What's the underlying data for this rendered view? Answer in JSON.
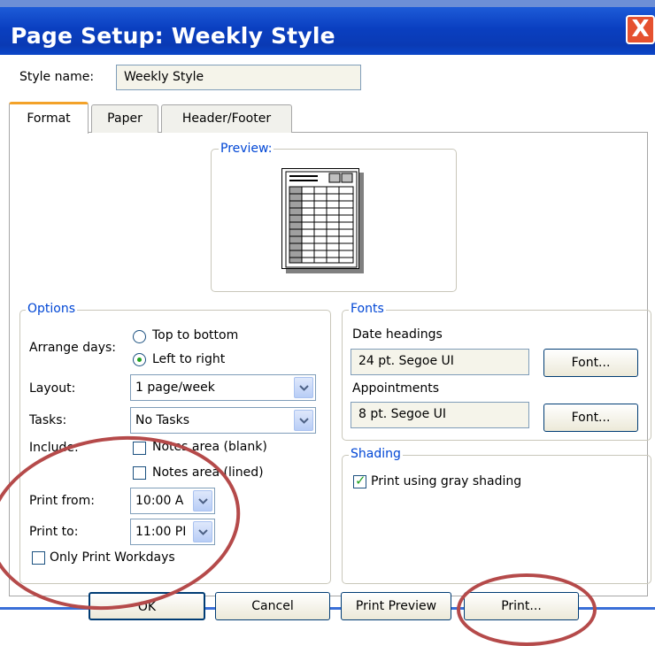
{
  "dialog": {
    "title": "Page Setup: Weekly Style",
    "close_glyph": "X"
  },
  "style_name": {
    "label": "Style name:",
    "value": "Weekly Style"
  },
  "tabs": [
    {
      "label": "Format",
      "active": true
    },
    {
      "label": "Paper",
      "active": false
    },
    {
      "label": "Header/Footer",
      "active": false
    }
  ],
  "preview": {
    "title": "Preview:"
  },
  "options": {
    "title": "Options",
    "arrange_days_label": "Arrange days:",
    "arrange_top_to_bottom": "Top to bottom",
    "arrange_left_to_right": "Left to right",
    "arrange_selected": "Left to right",
    "layout_label": "Layout:",
    "layout_value": "1 page/week",
    "tasks_label": "Tasks:",
    "tasks_value": "No Tasks",
    "include_label": "Include:",
    "notes_blank": "Notes area (blank)",
    "notes_lined": "Notes area (lined)",
    "notes_blank_checked": false,
    "notes_lined_checked": false,
    "print_from_label": "Print from:",
    "print_from_value": "10:00 A",
    "print_to_label": "Print to:",
    "print_to_value": "11:00 PI",
    "only_workdays": "Only Print Workdays",
    "only_workdays_checked": false
  },
  "fonts": {
    "title": "Fonts",
    "date_headings_label": "Date headings",
    "date_headings_value": "24 pt. Segoe UI",
    "appointments_label": "Appointments",
    "appointments_value": "8 pt. Segoe UI",
    "font_button": "Font..."
  },
  "shading": {
    "title": "Shading",
    "gray_shading": "Print using gray shading",
    "gray_shading_checked": true
  },
  "buttons": {
    "ok": "OK",
    "cancel": "Cancel",
    "print_preview": "Print Preview",
    "print": "Print..."
  },
  "colors": {
    "title_bar": "#0a3fc0",
    "group_title": "#0046d5",
    "tab_accent": "#f3a229",
    "annotation": "#b54a4a",
    "check_green": "#21a121"
  }
}
